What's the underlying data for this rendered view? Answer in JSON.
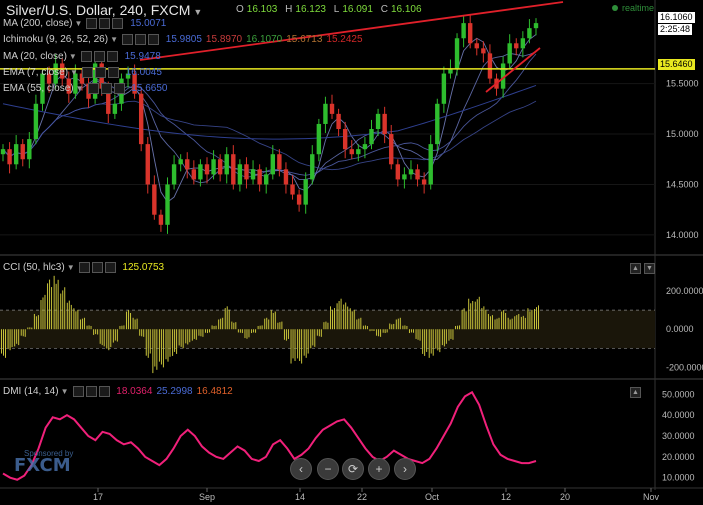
{
  "header": {
    "title": "Silver/U.S. Dollar, 240, FXCM",
    "ohlc": [
      {
        "k": "O",
        "v": "16.103"
      },
      {
        "k": "H",
        "v": "16.123"
      },
      {
        "k": "L",
        "v": "16.091"
      },
      {
        "k": "C",
        "v": "16.106"
      }
    ],
    "status": "realtime"
  },
  "indicators": [
    {
      "label": "MA (200, close)",
      "values": [
        {
          "v": "15.0071",
          "c": "#4a6bd6"
        }
      ]
    },
    {
      "label": "Ichimoku (9, 26, 52, 26)",
      "values": [
        {
          "v": "15.9805",
          "c": "#4a6bd6"
        },
        {
          "v": "15.8970",
          "c": "#c83c3c"
        },
        {
          "v": "16.1070",
          "c": "#3ca03c"
        },
        {
          "v": "15.6713",
          "c": "#b07030"
        },
        {
          "v": "15.2425",
          "c": "#d02828"
        }
      ]
    },
    {
      "label": "MA (20, close)",
      "values": [
        {
          "v": "15.9478",
          "c": "#4a6bd6"
        }
      ]
    },
    {
      "label": "EMA (7, close)",
      "values": [
        {
          "v": "16.0045",
          "c": "#4a6bd6"
        }
      ]
    },
    {
      "label": "EMA (55, close)",
      "values": [
        {
          "v": "15.6650",
          "c": "#4a6bd6"
        }
      ]
    }
  ],
  "price_boxes": {
    "last": "16.1060",
    "countdown": "2:25:48",
    "hline": "15.6460"
  },
  "cci_header": {
    "label": "CCI (50, hlc3)",
    "value": "125.0753"
  },
  "dmi_header": {
    "label": "DMI (14, 14)",
    "values": [
      {
        "v": "18.0364",
        "c": "#e0206a"
      },
      {
        "v": "25.2998",
        "c": "#4a6bd6"
      },
      {
        "v": "16.4812",
        "c": "#e0602a"
      }
    ]
  },
  "sponsor": {
    "line1": "Sponsored by",
    "brand": "FXCM"
  },
  "zoom_controls": [
    "‹",
    "−",
    "⟳",
    "+",
    "›"
  ],
  "colors": {
    "up": "#2ebd2e",
    "down": "#d9342b",
    "trendline": "#e0202a",
    "hline": "#e8e820",
    "cci": "#c7c23a",
    "dmi": "#f0207a"
  },
  "chart_data": [
    {
      "type": "line",
      "title": "Silver/U.S. Dollar, 240, FXCM",
      "x_ticks": [
        "17",
        "Sep",
        "14",
        "22",
        "Oct",
        "12",
        "20",
        "Nov"
      ],
      "y_ticks": [
        14.0,
        14.5,
        15.0,
        15.5
      ],
      "ylim": [
        13.85,
        16.25
      ],
      "series": [
        {
          "name": "price",
          "values": [
            14.85,
            14.7,
            14.9,
            14.75,
            14.95,
            15.3,
            15.6,
            15.5,
            15.7,
            15.55,
            15.4,
            15.6,
            15.5,
            15.35,
            15.7,
            15.45,
            15.2,
            15.3,
            15.55,
            15.6,
            15.4,
            14.9,
            14.5,
            14.2,
            14.1,
            14.5,
            14.7,
            14.75,
            14.65,
            14.55,
            14.7,
            14.6,
            14.75,
            14.6,
            14.8,
            14.5,
            14.7,
            14.55,
            14.65,
            14.5,
            14.6,
            14.8,
            14.65,
            14.5,
            14.4,
            14.3,
            14.55,
            14.8,
            15.1,
            15.3,
            15.2,
            15.05,
            14.85,
            14.8,
            14.85,
            14.9,
            15.05,
            15.2,
            15.0,
            14.7,
            14.55,
            14.6,
            14.65,
            14.55,
            14.5,
            14.9,
            15.3,
            15.6,
            15.65,
            15.95,
            16.1,
            15.9,
            15.85,
            15.8,
            15.55,
            15.45,
            15.7,
            15.9,
            15.85,
            15.95,
            16.05,
            16.1
          ]
        }
      ],
      "hline": 15.646
    },
    {
      "type": "bar",
      "title": "CCI (50, hlc3)",
      "y_ticks": [
        200,
        0,
        -200
      ],
      "ylim": [
        -240,
        300
      ],
      "bands": [
        100,
        -100
      ],
      "values": [
        -150,
        -110,
        -90,
        -40,
        10,
        80,
        180,
        260,
        280,
        220,
        150,
        110,
        60,
        20,
        -30,
        -90,
        -110,
        -70,
        20,
        100,
        60,
        -40,
        -150,
        -230,
        -200,
        -170,
        -140,
        -100,
        -80,
        -60,
        -40,
        -20,
        20,
        60,
        120,
        40,
        -20,
        -50,
        -20,
        20,
        60,
        100,
        40,
        -60,
        -180,
        -180,
        -150,
        -100,
        -40,
        40,
        120,
        160,
        140,
        110,
        60,
        20,
        -10,
        -40,
        -20,
        30,
        60,
        20,
        -20,
        -60,
        -140,
        -150,
        -120,
        -90,
        -60,
        20,
        110,
        160,
        170,
        120,
        80,
        60,
        100,
        60,
        80,
        70,
        110,
        125
      ]
    },
    {
      "type": "line",
      "title": "DMI (14, 14)",
      "y_ticks": [
        50,
        40,
        30,
        20,
        10
      ],
      "ylim": [
        6,
        54
      ],
      "series": [
        {
          "name": "DMI",
          "values": [
            12,
            10,
            9,
            11,
            16,
            24,
            34,
            39,
            38,
            40,
            38,
            34,
            30,
            28,
            32,
            31,
            28,
            26,
            27,
            24,
            20,
            18,
            16,
            19,
            24,
            30,
            33,
            30,
            25,
            22,
            20,
            19,
            22,
            25,
            23,
            19,
            18,
            20,
            26,
            28,
            24,
            19,
            21,
            24,
            29,
            33,
            35,
            37,
            38,
            34,
            29,
            24,
            20,
            18,
            20,
            23,
            21,
            19,
            18,
            17,
            19,
            24,
            30,
            36,
            44,
            49,
            51,
            45,
            35,
            26,
            21,
            19,
            18,
            17,
            17,
            18
          ]
        }
      ]
    }
  ]
}
